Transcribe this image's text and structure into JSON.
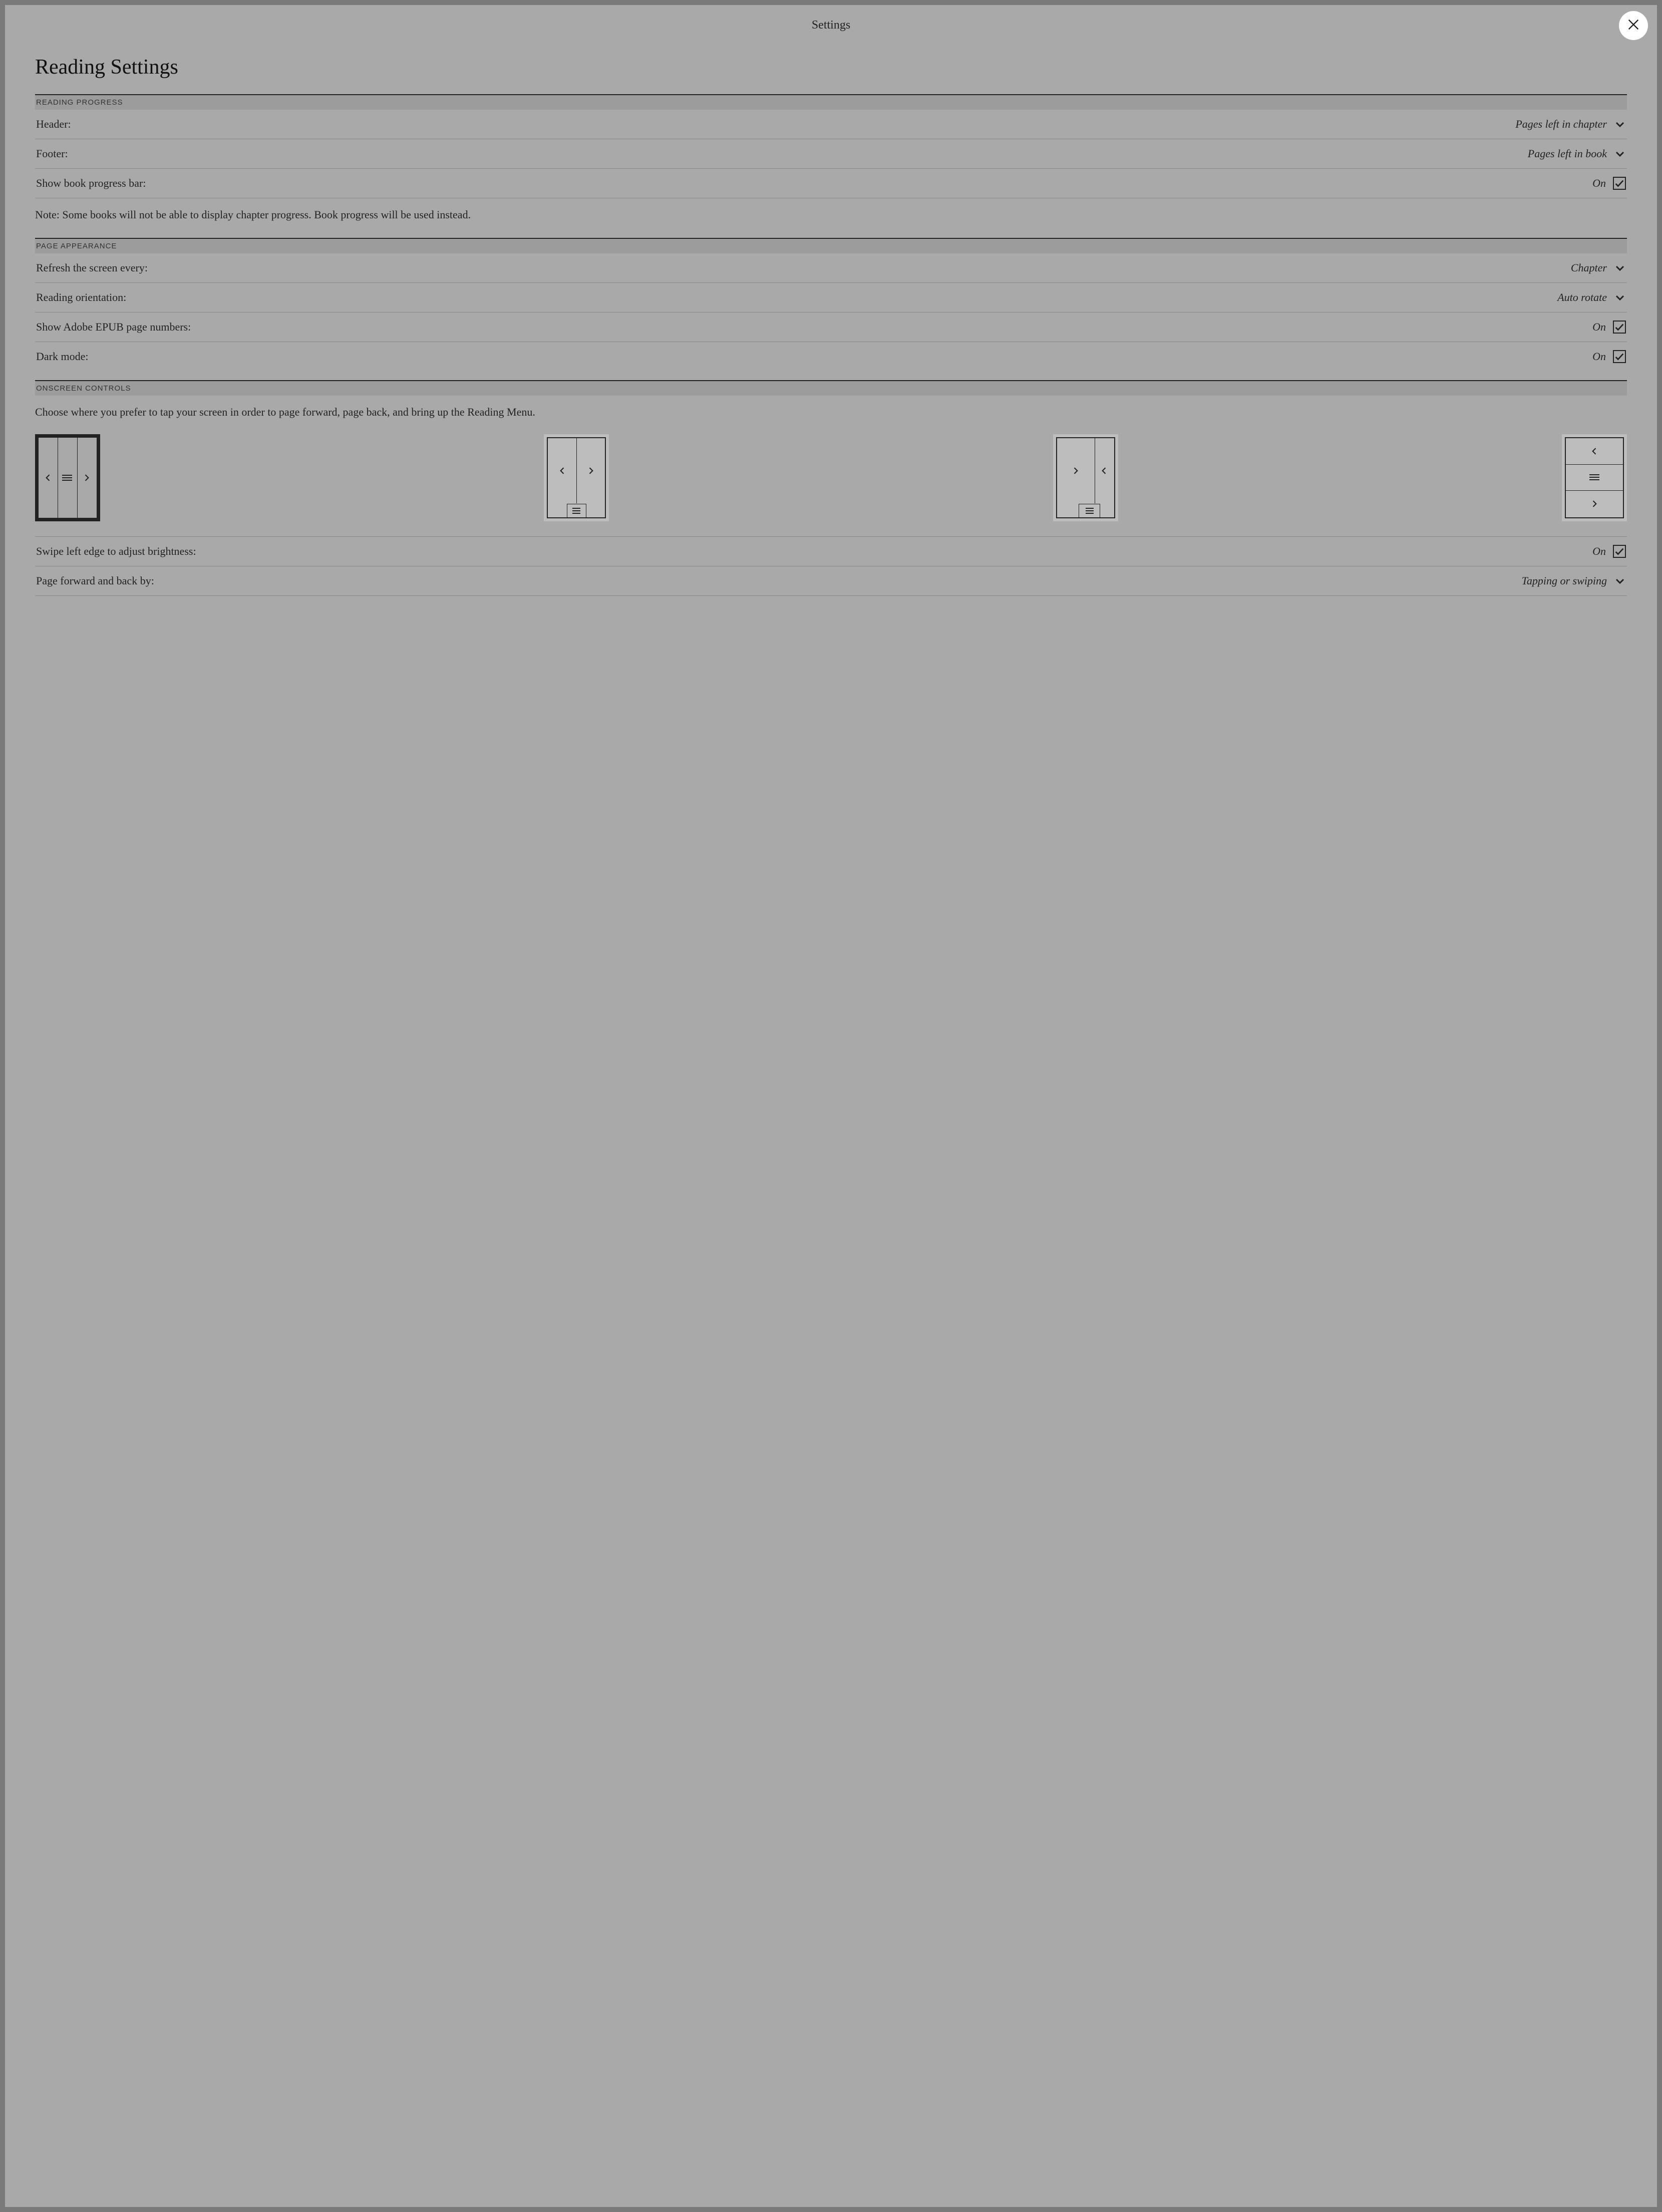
{
  "topbar": {
    "title": "Settings"
  },
  "page": {
    "title": "Reading Settings"
  },
  "sections": {
    "reading_progress": {
      "header": "READING PROGRESS",
      "header_row": {
        "label": "Header:",
        "value": "Pages left in chapter"
      },
      "footer_row": {
        "label": "Footer:",
        "value": "Pages left in book"
      },
      "progress_bar_row": {
        "label": "Show book progress bar:",
        "value": "On"
      },
      "note": "Note: Some books will not be able to display chapter progress. Book progress will be used instead."
    },
    "page_appearance": {
      "header": "PAGE APPEARANCE",
      "refresh_row": {
        "label": "Refresh the screen every:",
        "value": "Chapter"
      },
      "orientation_row": {
        "label": "Reading orientation:",
        "value": "Auto rotate"
      },
      "adobe_row": {
        "label": "Show Adobe EPUB page numbers:",
        "value": "On"
      },
      "dark_row": {
        "label": "Dark mode:",
        "value": "On"
      }
    },
    "onscreen_controls": {
      "header": "ONSCREEN CONTROLS",
      "intro": "Choose where you prefer to tap your screen in order to page forward, page back, and bring up the Reading Menu.",
      "layouts": [
        {
          "id": "layout-columns-left-menu-right",
          "selected": true
        },
        {
          "id": "layout-columns-menu-bottom",
          "selected": false
        },
        {
          "id": "layout-reversed-menu-bottom",
          "selected": false
        },
        {
          "id": "layout-rows-back-menu-forward",
          "selected": false
        }
      ],
      "swipe_row": {
        "label": "Swipe left edge to adjust brightness:",
        "value": "On"
      },
      "page_turn_row": {
        "label": "Page forward and back by:",
        "value": "Tapping or swiping"
      }
    }
  }
}
